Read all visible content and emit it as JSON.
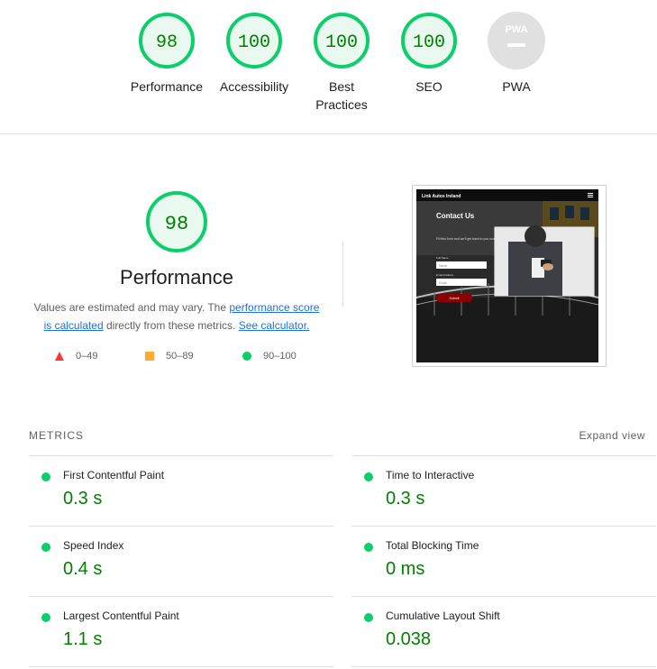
{
  "categories": [
    {
      "score": "98",
      "label": "Performance",
      "color": "#0cce6b"
    },
    {
      "score": "100",
      "label": "Accessibility",
      "color": "#0cce6b"
    },
    {
      "score": "100",
      "label": "Best Practices",
      "color": "#0cce6b"
    },
    {
      "score": "100",
      "label": "SEO",
      "color": "#0cce6b"
    },
    {
      "score": "PWA",
      "label": "PWA",
      "color": "#e0e0e0"
    }
  ],
  "performance": {
    "score": "98",
    "title": "Performance",
    "desc_before": "Values are estimated and may vary. The ",
    "link_score": "performance score is calculated",
    "desc_middle": " directly from these metrics. ",
    "link_calc": "See calculator.",
    "legend": {
      "fail": "0–49",
      "average": "50–89",
      "pass": "90–100"
    },
    "colors": {
      "fail": "#ff3333",
      "average": "#ffaa33",
      "pass": "#0cce6b"
    }
  },
  "screenshot": {
    "site_title": "Link Autos Ireland",
    "heading": "Contact Us",
    "body_text": "Fill this form and we'll get back to you soon.",
    "field1_label": "Full Name",
    "field1_placeholder": "Name",
    "field2_label": "Email Address",
    "field2_placeholder": "Email",
    "submit_label": "Submit"
  },
  "metrics": {
    "title": "METRICS",
    "expand_label": "Expand view",
    "items": [
      {
        "name": "First Contentful Paint",
        "value": "0.3 s"
      },
      {
        "name": "Time to Interactive",
        "value": "0.3 s"
      },
      {
        "name": "Speed Index",
        "value": "0.4 s"
      },
      {
        "name": "Total Blocking Time",
        "value": "0 ms"
      },
      {
        "name": "Largest Contentful Paint",
        "value": "1.1 s"
      },
      {
        "name": "Cumulative Layout Shift",
        "value": "0.038"
      }
    ]
  }
}
